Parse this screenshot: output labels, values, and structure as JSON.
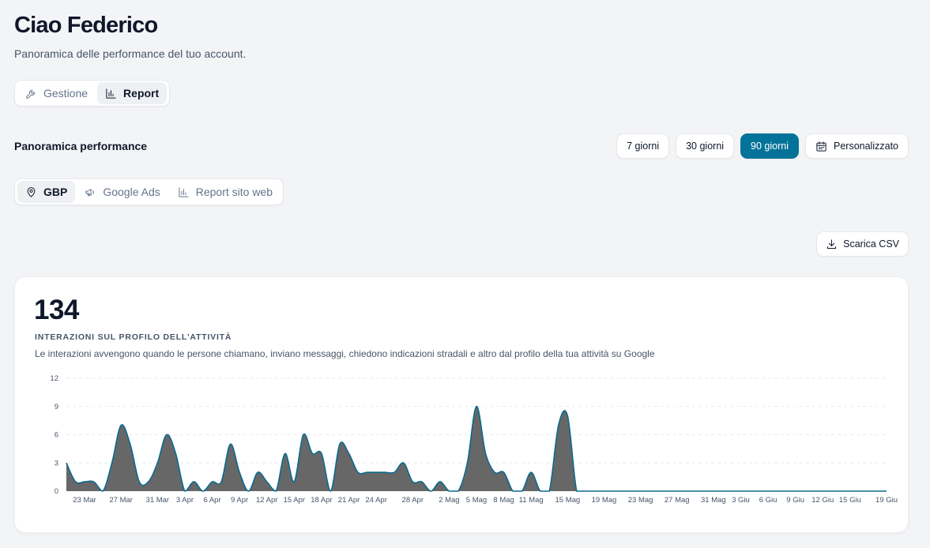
{
  "header": {
    "greeting": "Ciao Federico",
    "subtitle": "Panoramica delle performance del tuo account."
  },
  "main_tabs": [
    {
      "label": "Gestione",
      "icon": "wrench-icon",
      "active": false
    },
    {
      "label": "Report",
      "icon": "bar-chart-icon",
      "active": true
    }
  ],
  "section": {
    "title": "Panoramica performance"
  },
  "date_ranges": [
    {
      "label": "7 giorni",
      "active": false
    },
    {
      "label": "30 giorni",
      "active": false
    },
    {
      "label": "90 giorni",
      "active": true
    },
    {
      "label": "Personalizzato",
      "icon": "calendar-icon",
      "active": false
    }
  ],
  "sub_tabs": [
    {
      "label": "GBP",
      "icon": "map-pin-icon",
      "active": true
    },
    {
      "label": "Google Ads",
      "icon": "megaphone-icon",
      "active": false
    },
    {
      "label": "Report sito web",
      "icon": "bar-chart-icon",
      "active": false
    }
  ],
  "actions": {
    "download_csv": "Scarica CSV",
    "download_icon": "download-icon"
  },
  "colors": {
    "accent": "#03739a",
    "area_fill": "#676767",
    "line": "#0b6a8e"
  },
  "metric": {
    "value": "134",
    "label": "INTERAZIONI SUL PROFILO DELL'ATTIVITÀ",
    "description": "Le interazioni avvengono quando le persone chiamano, inviano messaggi, chiedono indicazioni stradali e altro dal profilo della tua attività su Google"
  },
  "chart_data": {
    "type": "area",
    "title": "",
    "xlabel": "",
    "ylabel": "",
    "ylim": [
      0,
      12
    ],
    "y_ticks": [
      "0",
      "3",
      "6",
      "9",
      "12"
    ],
    "grid": true,
    "legend": "none",
    "x_tick_labels": [
      "23 Mar",
      "27 Mar",
      "31 Mar",
      "3 Apr",
      "6 Apr",
      "9 Apr",
      "12 Apr",
      "15 Apr",
      "18 Apr",
      "21 Apr",
      "24 Apr",
      "28 Apr",
      "2 Mag",
      "5 Mag",
      "8 Mag",
      "11 Mag",
      "15 Mag",
      "19 Mag",
      "23 Mag",
      "27 Mag",
      "31 Mag",
      "3 Giu",
      "6 Giu",
      "9 Giu",
      "12 Giu",
      "15 Giu",
      "19 Giu"
    ],
    "x_tick_day_index": [
      2,
      6,
      10,
      13,
      16,
      19,
      22,
      25,
      28,
      31,
      34,
      38,
      42,
      45,
      48,
      51,
      55,
      59,
      63,
      67,
      71,
      74,
      77,
      80,
      83,
      86,
      90
    ],
    "series": [
      {
        "values": [
          3,
          1,
          1,
          1,
          0,
          3,
          7,
          5,
          1,
          1,
          3,
          6,
          4,
          0,
          1,
          0,
          1,
          1,
          5,
          2,
          0,
          2,
          1,
          0,
          4,
          1,
          6,
          4,
          4,
          0,
          5,
          4,
          2,
          2,
          2,
          2,
          2,
          3,
          1,
          1,
          0,
          1,
          0,
          0,
          3,
          9,
          4,
          2,
          2,
          0,
          0,
          2,
          0,
          0,
          7,
          8,
          0,
          0,
          0,
          0,
          0,
          0,
          0,
          0,
          0,
          0,
          0,
          0,
          0,
          0,
          0,
          0,
          0,
          0,
          0,
          0,
          0,
          0,
          0,
          0,
          0,
          0,
          0,
          0,
          0,
          0,
          0,
          0,
          0,
          0,
          0
        ]
      }
    ]
  }
}
